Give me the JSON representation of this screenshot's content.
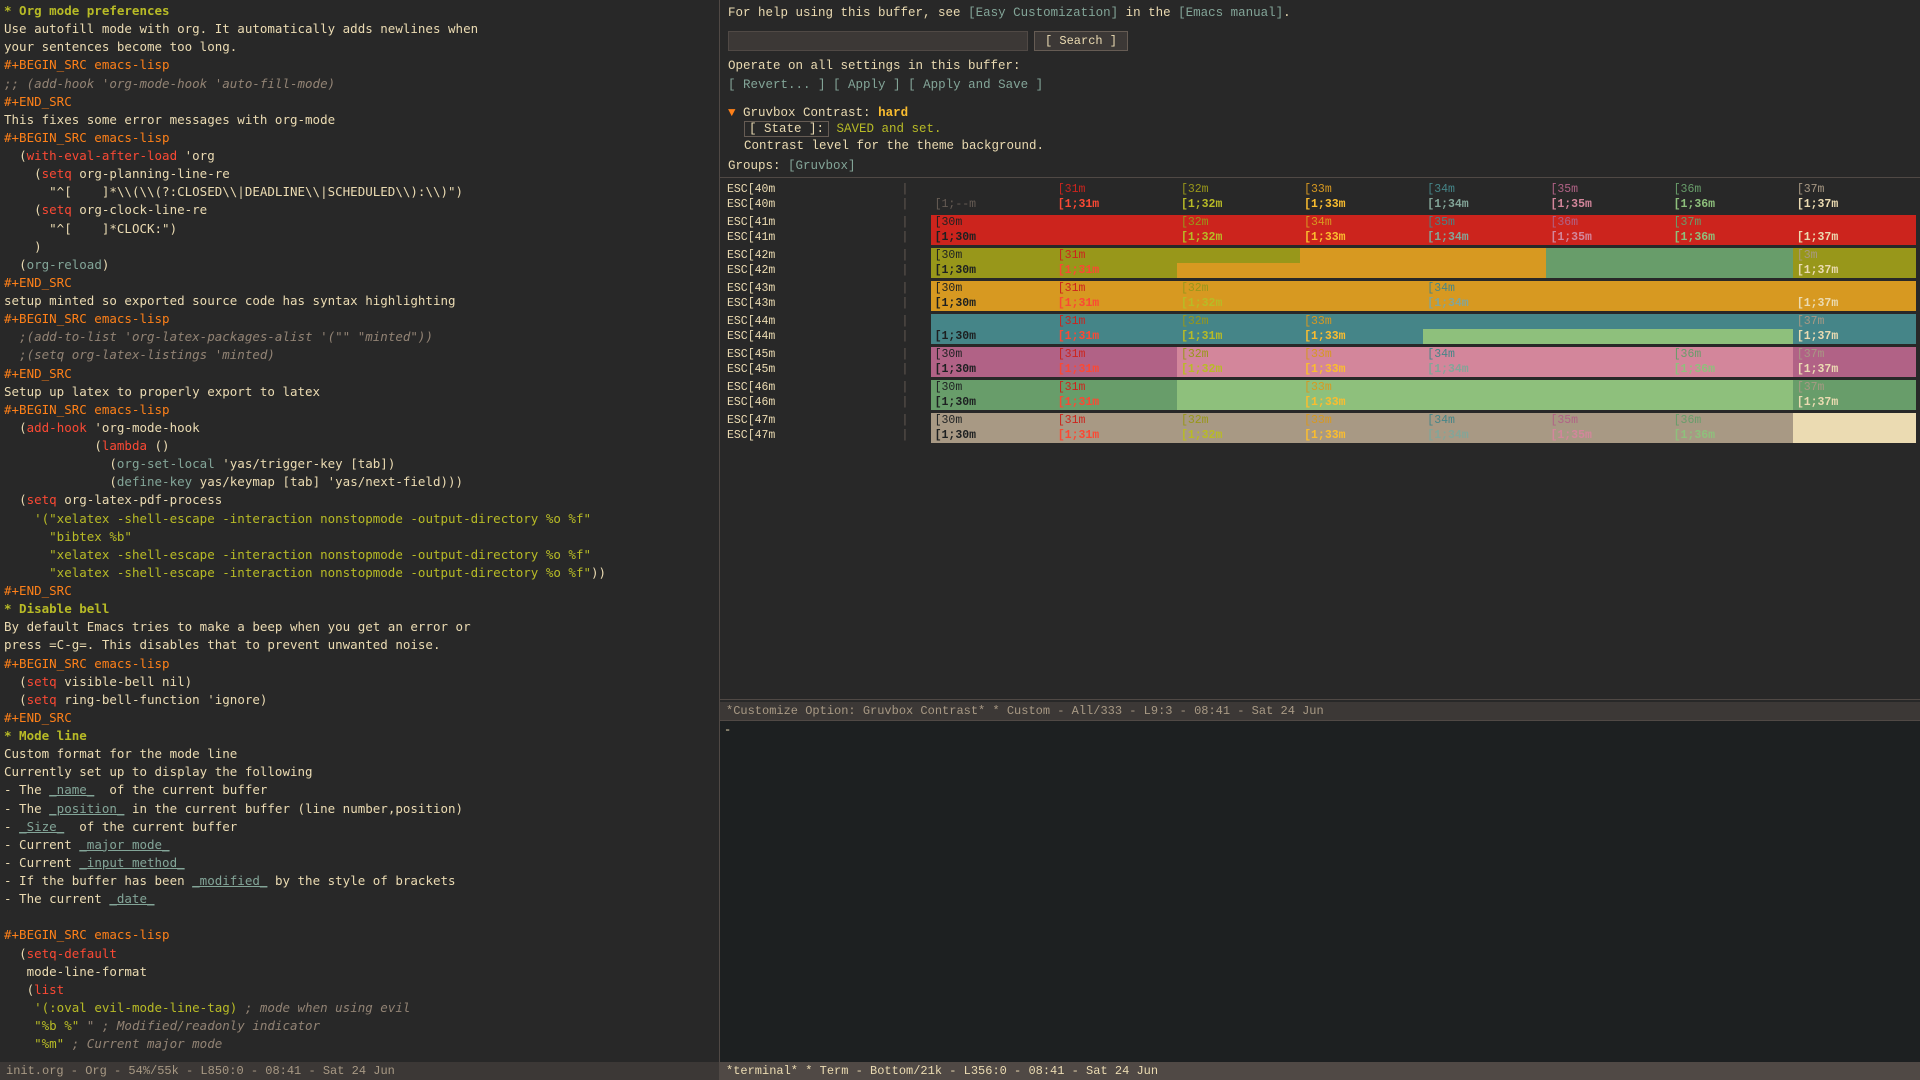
{
  "left_panel": {
    "statusbar": "init.org - Org - 54%/55k - L850:0 - 08:41 - Sat 24 Jun"
  },
  "right_panel": {
    "help_text": "For help using this buffer, see",
    "easy_customization_link": "[Easy Customization]",
    "in_text": "in the",
    "emacs_manual_link": "[Emacs manual]",
    "operate_text": "Operate on all settings in this buffer:",
    "revert_btn": "[ Revert... ]",
    "apply_btn": "[ Apply ]",
    "apply_save_btn": "[ Apply and Save ]",
    "search_placeholder": "",
    "search_btn": "[ Search ]",
    "setting": {
      "toggle": "▼",
      "name": "Gruvbox Contrast:",
      "value": "hard",
      "state_label": "[ State ]:",
      "state_value": "SAVED and set.",
      "description": "Contrast level for the theme background.",
      "groups_label": "Groups:",
      "groups_link": "[Gruvbox]"
    },
    "statusbar": "*Customize Option: Gruvbox Contrast* * Custom - All/333 - L9:3 - 08:41 - Sat 24 Jun"
  },
  "terminal": {
    "statusbar": "*terminal* * Term - Bottom/21k - L356:0 - 08:41 - Sat 24 Jun",
    "cursor": "-"
  },
  "color_rows": [
    {
      "label1": "ESC[40m",
      "label2": "ESC[40m",
      "cells_top": [
        "",
        "[31m",
        "[32m",
        "[33m",
        "[34m",
        "[35m",
        "[36m",
        "[37m"
      ],
      "cells_bot": [
        "[1;--m",
        "[1;31m",
        "[1;32m",
        "[1;33m",
        "[1;34m",
        "[1;35m",
        "[1;36m",
        "[1;37m"
      ],
      "bg_top": "bg40",
      "bg_bot": "bg40b"
    }
  ]
}
